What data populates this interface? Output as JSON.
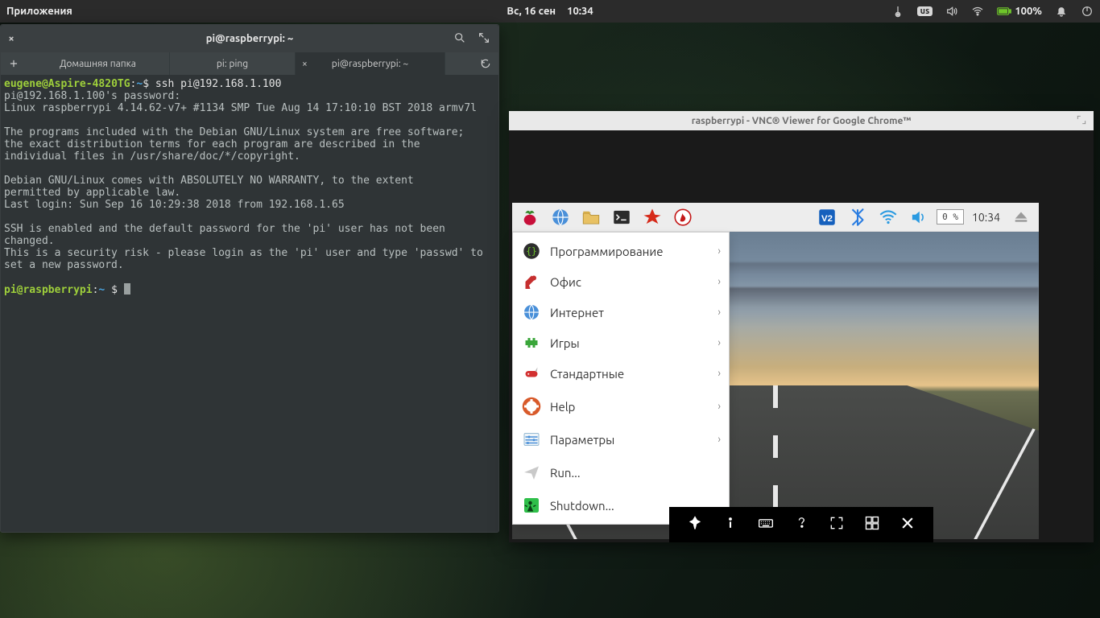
{
  "top_panel": {
    "apps_label": "Приложения",
    "date": "Вс, 16 сен",
    "time": "10:34",
    "lang": "us",
    "battery": "100%"
  },
  "terminal": {
    "title": "pi@raspberrypi: ~",
    "tabs": [
      {
        "label": "Домашняя папка",
        "active": false,
        "close": false
      },
      {
        "label": "pi: ping",
        "active": false,
        "close": false
      },
      {
        "label": "pi@raspberrypi: ~",
        "active": true,
        "close": true
      }
    ],
    "lines": {
      "l1_user": "eugene",
      "l1_at": "@",
      "l1_host": "Aspire-4820TG",
      "l1_colon": ":",
      "l1_path": "~",
      "l1_prompt": "$",
      "l1_cmd": " ssh pi@192.168.1.100",
      "l2": "pi@192.168.1.100's password:",
      "l3": "Linux raspberrypi 4.14.62-v7+ #1134 SMP Tue Aug 14 17:10:10 BST 2018 armv7l",
      "l5": "The programs included with the Debian GNU/Linux system are free software;",
      "l6": "the exact distribution terms for each program are described in the",
      "l7": "individual files in /usr/share/doc/*/copyright.",
      "l9": "Debian GNU/Linux comes with ABSOLUTELY NO WARRANTY, to the extent",
      "l10": "permitted by applicable law.",
      "l11": "Last login: Sun Sep 16 10:29:38 2018 from 192.168.1.65",
      "l13": "SSH is enabled and the default password for the 'pi' user has not been changed.",
      "l14": "This is a security risk - please login as the 'pi' user and type 'passwd' to set a new password.",
      "p2_user": "pi",
      "p2_host": "raspberrypi",
      "p2_path": "~",
      "p2_dollar": "$"
    }
  },
  "vnc": {
    "title": "raspberrypi - VNC® Viewer for Google Chrome™",
    "taskbar": {
      "cpu": "0 %",
      "clock": "10:34"
    },
    "menu": [
      {
        "label": "Программирование",
        "sub": true,
        "icon": "braces"
      },
      {
        "label": "Офис",
        "sub": true,
        "icon": "lamp"
      },
      {
        "label": "Интернет",
        "sub": true,
        "icon": "globe"
      },
      {
        "label": "Игры",
        "sub": true,
        "icon": "invader"
      },
      {
        "label": "Стандартные",
        "sub": true,
        "icon": "knife"
      },
      {
        "label": "Help",
        "sub": true,
        "icon": "buoy"
      },
      {
        "label": "Параметры",
        "sub": true,
        "icon": "sliders"
      },
      {
        "label": "Run...",
        "sub": false,
        "icon": "plane"
      },
      {
        "label": "Shutdown...",
        "sub": false,
        "icon": "exit"
      }
    ]
  }
}
